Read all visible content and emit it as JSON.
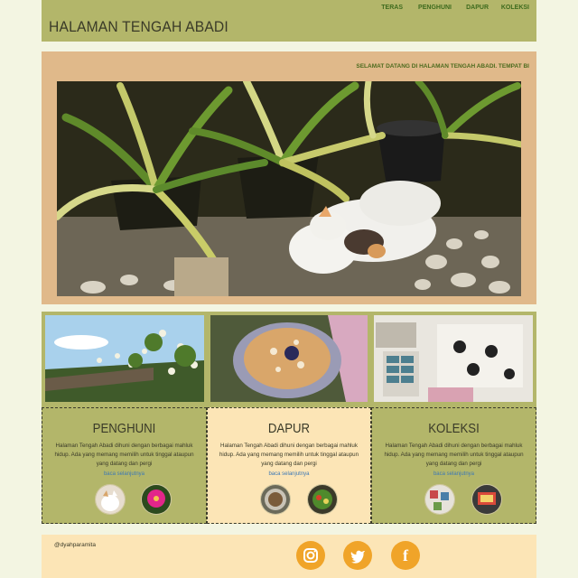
{
  "site_title": "HALAMAN TENGAH ABADI",
  "nav": [
    "TERAS",
    "PENGHUNI",
    "DAPUR",
    "KOLEKSI"
  ],
  "welcome": "SELAMAT DATANG DI HALAMAN TENGAH ABADI. TEMPAT BI",
  "hero": {
    "image": "potted plants with sleeping white cats on pebbles"
  },
  "gallery": [
    {
      "image": "flowering vine over roof"
    },
    {
      "image": "flatbread with berries on plate"
    },
    {
      "image": "postcards and stamps collection"
    }
  ],
  "sections": [
    {
      "title": "PENGHUNI",
      "text": "Halaman Tengah Abadi dihuni dengan berbagai mahluk hidup. Ada yang memang memilih untuk tinggal ataupun yang datang dan pergi",
      "link": "baca selanjutnya",
      "bg": "#b3b66a"
    },
    {
      "title": "DAPUR",
      "text": "Halaman Tengah Abadi dihuni dengan berbagai mahluk hidup. Ada yang memang memilih untuk tinggal ataupun yang datang dan pergi",
      "link": "baca selanjutnya",
      "bg": "#fce5b6"
    },
    {
      "title": "KOLEKSI",
      "text": "Halaman Tengah Abadi dihuni dengan berbagai mahluk hidup. Ada yang memang memilih untuk tinggal ataupun yang datang dan pergi",
      "link": "baca selanjutnya",
      "bg": "#b3b66a"
    }
  ],
  "footer": {
    "credit": "@dyahparamita",
    "social": [
      {
        "icon": "instagram-icon"
      },
      {
        "icon": "twitter-icon"
      },
      {
        "icon": "facebook-icon",
        "glyph": "f"
      }
    ]
  },
  "colors": {
    "header_bg": "#b3b66a",
    "hero_frame": "#e0b98a",
    "footer_bg": "#fce5b6",
    "nav_text": "#3e6b1e",
    "link": "#3d78b5",
    "social": "#f0a429"
  }
}
